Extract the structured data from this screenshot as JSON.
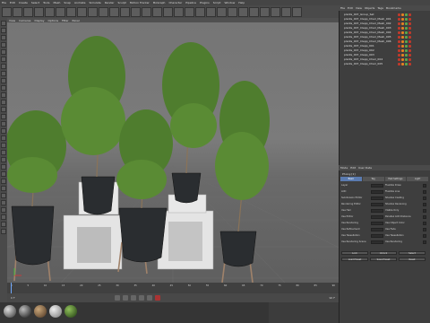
{
  "menubar": {
    "items": [
      "File",
      "Edit",
      "Create",
      "Select",
      "Tools",
      "Mesh",
      "Snap",
      "Animate",
      "Simulate",
      "Render",
      "Sculpt",
      "Motion Tracker",
      "MoGraph",
      "Character",
      "Pipeline",
      "Plugins",
      "Script",
      "Window",
      "Help"
    ]
  },
  "viewport": {
    "menu": [
      "View",
      "Cameras",
      "Display",
      "Options",
      "Filter",
      "Panel"
    ]
  },
  "object_manager": {
    "menu": [
      "File",
      "Edit",
      "View",
      "Objects",
      "Tags",
      "Bookmarks"
    ],
    "rows": [
      "plants_007_Group_Set",
      "plants_007_Clepp_Chair_Mesh_001",
      "plants_007_Clepp_Chair_Mesh_002",
      "plants_007_Clepp_Chair_Mesh_003",
      "plants_007_Clepp_Chair_Mesh_004",
      "plants_007_Clepp_Chair_Mesh_005",
      "plants_007_Clepp_Chair_Mesh_006",
      "plants_007_Clepp_001",
      "plants_007_Clepp_002",
      "plants_007_Clepp_003",
      "plants_007_Clepp_Chair_004",
      "plants_007_Clepp_Chair_005"
    ]
  },
  "attribute_manager": {
    "menu": [
      "Mode",
      "Edit",
      "User Data"
    ],
    "title": "Phong [1]",
    "tabs": [
      "Basic",
      "Tag",
      "Fast Settings",
      "Light"
    ],
    "left_fields": [
      "Layer",
      "LOD",
      "Subdivision Editor",
      "Rendering Editor",
      "Use Hair",
      "Use Editor",
      "Use Rendering",
      "Use Refinement",
      "Use Tessellation",
      "Use Rendering Scene"
    ],
    "right_fields": [
      "Flexible Draw",
      "Flexible Line",
      "Shadow Casting",
      "Shadow Receiving",
      "Visible Only",
      "Parallax LOD Distance",
      "Use Object Color",
      "Use Fade",
      "Use Tessellation",
      "Use Rendering"
    ],
    "buttons": [
      "Lock",
      "Unlock",
      "Select",
      "Load Preset",
      "Save Preset",
      "Reset"
    ]
  },
  "timeline": {
    "ticks": [
      "0",
      "5",
      "10",
      "15",
      "20",
      "25",
      "30",
      "35",
      "40",
      "45",
      "50",
      "55",
      "60",
      "65",
      "70",
      "75",
      "80",
      "85",
      "90"
    ],
    "current": "0 F",
    "end": "90 F"
  },
  "colors": {
    "accent": "#5a7bb0",
    "tag_red": "#c0392b",
    "tag_orange": "#e67e22",
    "tag_green": "#5aa64b"
  }
}
